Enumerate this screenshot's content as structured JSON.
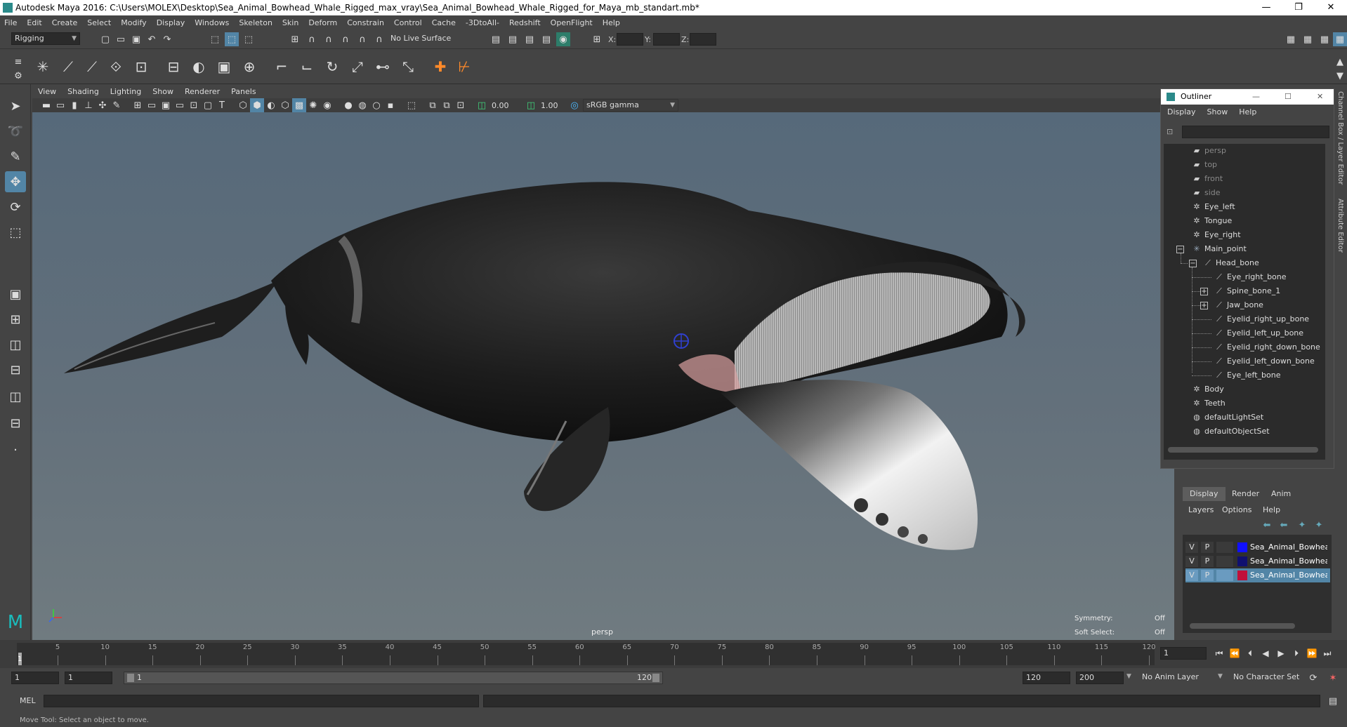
{
  "window": {
    "title": "Autodesk Maya 2016: C:\\Users\\MOLEX\\Desktop\\Sea_Animal_Bowhead_Whale_Rigged_max_vray\\Sea_Animal_Bowhead_Whale_Rigged_for_Maya_mb_standart.mb*",
    "minimize": "—",
    "maximize": "❐",
    "close": "✕"
  },
  "menubar": [
    "File",
    "Edit",
    "Create",
    "Select",
    "Modify",
    "Display",
    "Windows",
    "Skeleton",
    "Skin",
    "Deform",
    "Constrain",
    "Control",
    "Cache",
    "-3DtoAll-",
    "Redshift",
    "OpenFlight",
    "Help"
  ],
  "status": {
    "mode": "Rigging",
    "live_surface": "No Live Surface",
    "x_label": "X:",
    "y_label": "Y:",
    "z_label": "Z:"
  },
  "viewport": {
    "menu": [
      "View",
      "Shading",
      "Lighting",
      "Show",
      "Renderer",
      "Panels"
    ],
    "exposure": "0.00",
    "gamma": "1.00",
    "colorspace": "sRGB gamma",
    "camera": "persp",
    "symmetry_label": "Symmetry:",
    "symmetry_value": "Off",
    "softselect_label": "Soft Select:",
    "softselect_value": "Off"
  },
  "outliner": {
    "title": "Outliner",
    "menu": [
      "Display",
      "Show",
      "Help"
    ],
    "items": [
      {
        "label": "persp",
        "dim": true
      },
      {
        "label": "top",
        "dim": true
      },
      {
        "label": "front",
        "dim": true
      },
      {
        "label": "side",
        "dim": true
      },
      {
        "label": "Eye_left"
      },
      {
        "label": "Tongue"
      },
      {
        "label": "Eye_right"
      },
      {
        "label": "Main_point"
      },
      {
        "label": "Head_bone"
      },
      {
        "label": "Eye_right_bone"
      },
      {
        "label": "Spine_bone_1"
      },
      {
        "label": "Jaw_bone"
      },
      {
        "label": "Eyelid_right_up_bone"
      },
      {
        "label": "Eyelid_left_up_bone"
      },
      {
        "label": "Eyelid_right_down_bone"
      },
      {
        "label": "Eyelid_left_down_bone"
      },
      {
        "label": "Eye_left_bone"
      },
      {
        "label": "Body"
      },
      {
        "label": "Teeth"
      },
      {
        "label": "defaultLightSet"
      },
      {
        "label": "defaultObjectSet"
      }
    ]
  },
  "side_tabs": {
    "channel_box": "Channel Box / Layer Editor",
    "attribute_editor": "Attribute Editor"
  },
  "layers": {
    "tabs": [
      "Display",
      "Render",
      "Anim"
    ],
    "menu": [
      "Layers",
      "Options",
      "Help"
    ],
    "rows": [
      {
        "v": "V",
        "p": "P",
        "color": "#1010ff",
        "name": "Sea_Animal_Bowhead_",
        "selected": false
      },
      {
        "v": "V",
        "p": "P",
        "color": "#101070",
        "name": "Sea_Animal_Bowhead_",
        "selected": false
      },
      {
        "v": "V",
        "p": "P",
        "color": "#c0103a",
        "name": "Sea_Animal_Bowhead_",
        "selected": true
      }
    ]
  },
  "timeline": {
    "ticks": [
      1,
      5,
      10,
      15,
      20,
      25,
      30,
      35,
      40,
      45,
      50,
      55,
      60,
      65,
      70,
      75,
      80,
      85,
      90,
      95,
      100,
      105,
      110,
      115,
      120
    ],
    "current_frame": "1",
    "range_start": "1",
    "range_inner_start": "1",
    "slider_start": "1",
    "slider_end": "120",
    "range_inner_end": "120",
    "range_end": "200",
    "anim_layer": "No Anim Layer",
    "character_set": "No Character Set"
  },
  "command": {
    "lang": "MEL"
  },
  "help_line": "Move Tool: Select an object to move."
}
